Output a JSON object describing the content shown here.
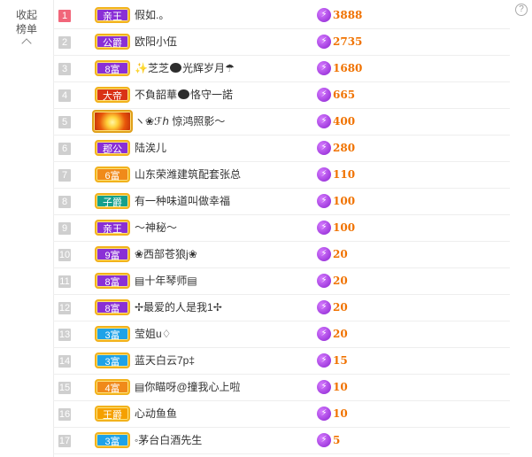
{
  "sidebar": {
    "collapse_label": "收起",
    "collapse_label2": "榜单",
    "chevron": "chevron-up-icon"
  },
  "help_glyph": "?",
  "colors": {
    "rank_top": "#f1667a",
    "rank_default": "#cfcfcf",
    "score": "#f07200",
    "bolt": "#8b23d1"
  },
  "rows": [
    {
      "rank": "1",
      "badge": "亲王",
      "badge_style": "purple",
      "name": "假如.。",
      "score": "3888"
    },
    {
      "rank": "2",
      "badge": "公爵",
      "badge_style": "purple",
      "name": "欧阳小伍",
      "score": "2735"
    },
    {
      "rank": "3",
      "badge": "8富",
      "badge_style": "purple",
      "name": "芝芝",
      "name_suffix": "光辉岁月☂",
      "score": "1680"
    },
    {
      "rank": "4",
      "badge": "大帝",
      "badge_style": "red",
      "name": "不負韶華",
      "name_suffix": "恪守一諾",
      "score": "665"
    },
    {
      "rank": "5",
      "badge": "",
      "badge_style": "flash",
      "name": "ヽ❀ℱℎ 惊鸿照影～",
      "score": "400"
    },
    {
      "rank": "6",
      "badge": "郡公",
      "badge_style": "purple",
      "name": "陆涘儿",
      "score": "280"
    },
    {
      "rank": "7",
      "badge": "6富",
      "badge_style": "orange",
      "name": "山东荣潍建筑配套张总",
      "score": "110"
    },
    {
      "rank": "8",
      "badge": "子爵",
      "badge_style": "teal",
      "name": "有一种味道叫做幸福",
      "score": "100"
    },
    {
      "rank": "9",
      "badge": "亲王",
      "badge_style": "purple",
      "name": "～神秘～",
      "score": "100"
    },
    {
      "rank": "10",
      "badge": "9富",
      "badge_style": "purple",
      "name": "❀西部苍狼j❀",
      "score": "20"
    },
    {
      "rank": "11",
      "badge": "8富",
      "badge_style": "purple",
      "name": "▤十年琴师▤",
      "score": "20"
    },
    {
      "rank": "12",
      "badge": "8富",
      "badge_style": "purple",
      "name": "✢最爱的人是我1✢",
      "score": "20"
    },
    {
      "rank": "13",
      "badge": "3富",
      "badge_style": "blue",
      "name": "莹姐u♢",
      "score": "20"
    },
    {
      "rank": "14",
      "badge": "3富",
      "badge_style": "blue",
      "name": "蓝天白云7p‡",
      "score": "15"
    },
    {
      "rank": "15",
      "badge": "4富",
      "badge_style": "orange",
      "name": "▤你瞄呀@撞我心上啦",
      "score": "10"
    },
    {
      "rank": "16",
      "badge": "王爵",
      "badge_style": "gold",
      "name": "心动鱼鱼",
      "score": "10"
    },
    {
      "rank": "17",
      "badge": "3富",
      "badge_style": "blue",
      "name": "◦茅台白酒先生",
      "score": "5"
    }
  ]
}
